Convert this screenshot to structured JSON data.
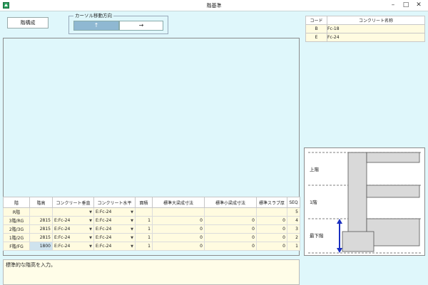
{
  "window": {
    "title": "階基準"
  },
  "toolbar": {
    "kaikousei_button": "階構成",
    "cursor_group_label": "カーソル移動方向",
    "dir_up": "↑",
    "dir_right": "→"
  },
  "concrete_list": {
    "headers": [
      "コード",
      "コンクリート名称"
    ],
    "rows": [
      {
        "code": "B",
        "name": "Fc-18"
      },
      {
        "code": "E",
        "name": "Fc-24"
      }
    ]
  },
  "floor_table": {
    "headers": [
      "階",
      "階高",
      "コンクリート垂直",
      "コンクリート水平",
      "面積",
      "標準大梁成寸法",
      "標準小梁成寸法",
      "標準スラブ厚",
      "SEQ"
    ],
    "rows": [
      {
        "floor": "R階",
        "height": "",
        "vertical": "",
        "horizontal": "E:Fc-24",
        "area": "",
        "beam_large": "",
        "beam_small": "",
        "slab": "",
        "seq": "5"
      },
      {
        "floor": "3階/RG",
        "height": "2815",
        "vertical": "E:Fc-24",
        "horizontal": "E:Fc-24",
        "area": "1",
        "beam_large": "0",
        "beam_small": "0",
        "slab": "0",
        "seq": "4"
      },
      {
        "floor": "2階/3G",
        "height": "2815",
        "vertical": "E:Fc-24",
        "horizontal": "E:Fc-24",
        "area": "1",
        "beam_large": "0",
        "beam_small": "0",
        "slab": "0",
        "seq": "3"
      },
      {
        "floor": "1階/2G",
        "height": "2815",
        "vertical": "E:Fc-24",
        "horizontal": "E:Fc-24",
        "area": "1",
        "beam_large": "0",
        "beam_small": "0",
        "slab": "0",
        "seq": "2"
      },
      {
        "floor": "F階/FG",
        "height": "1800",
        "vertical": "E:Fc-24",
        "horizontal": "E:Fc-24",
        "area": "1",
        "beam_large": "0",
        "beam_small": "0",
        "slab": "0",
        "seq": "1"
      }
    ]
  },
  "message": "標準的な階高を入力。",
  "diagram": {
    "labels": {
      "upper": "上階",
      "one": "1階",
      "lowest": "最下階"
    }
  }
}
